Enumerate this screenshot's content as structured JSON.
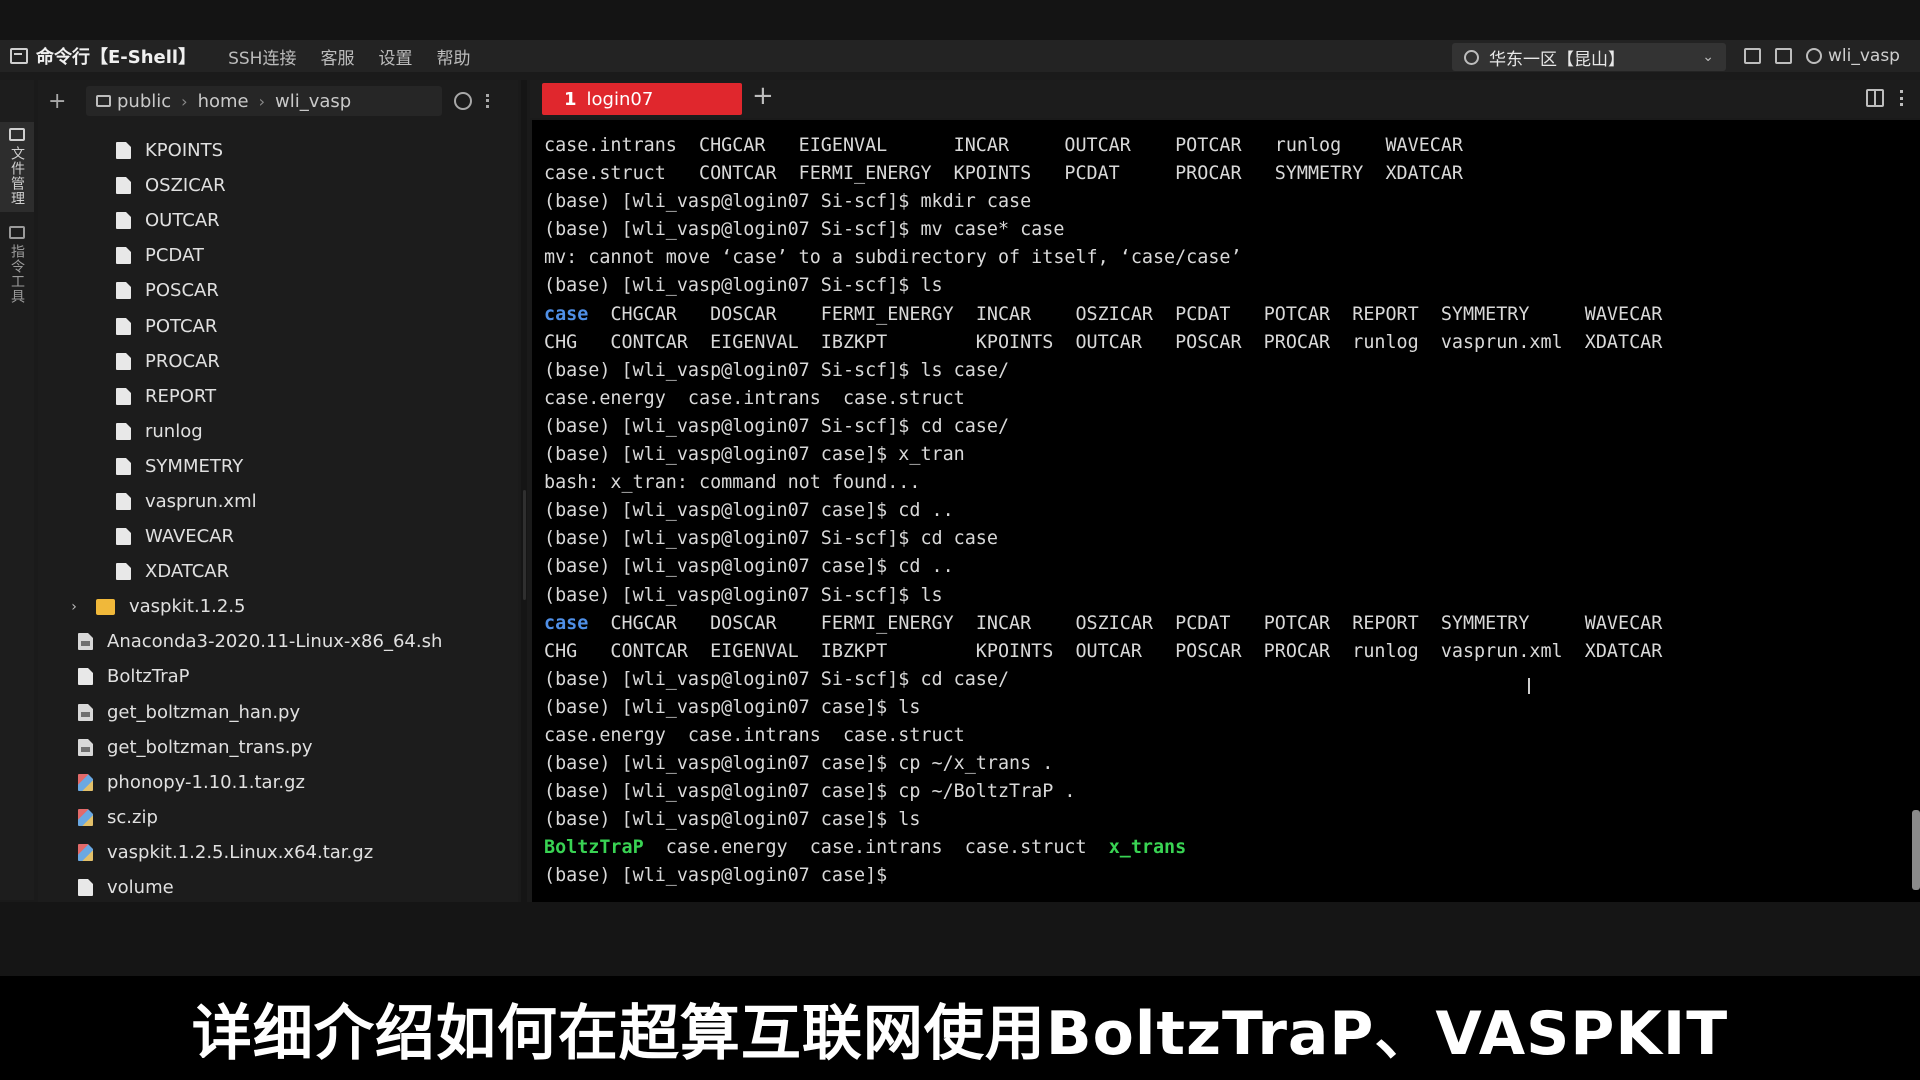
{
  "app": {
    "title": "命令行【E-Shell】",
    "menu": [
      "SSH连接",
      "客服",
      "设置",
      "帮助"
    ],
    "region": "华东一区【昆山】",
    "user": "wli_vasp"
  },
  "rail": {
    "files": "文件管理",
    "commands": "指令工具"
  },
  "filepanel": {
    "breadcrumb": [
      "public",
      "home",
      "wli_vasp"
    ],
    "files": [
      {
        "name": "KPOINTS",
        "kind": "file",
        "level": "child"
      },
      {
        "name": "OSZICAR",
        "kind": "file",
        "level": "child"
      },
      {
        "name": "OUTCAR",
        "kind": "file",
        "level": "child"
      },
      {
        "name": "PCDAT",
        "kind": "file",
        "level": "child"
      },
      {
        "name": "POSCAR",
        "kind": "file",
        "level": "child"
      },
      {
        "name": "POTCAR",
        "kind": "file",
        "level": "child"
      },
      {
        "name": "PROCAR",
        "kind": "file",
        "level": "child"
      },
      {
        "name": "REPORT",
        "kind": "file",
        "level": "child"
      },
      {
        "name": "runlog",
        "kind": "file",
        "level": "child"
      },
      {
        "name": "SYMMETRY",
        "kind": "file",
        "level": "child"
      },
      {
        "name": "vasprun.xml",
        "kind": "file",
        "level": "child"
      },
      {
        "name": "WAVECAR",
        "kind": "file",
        "level": "child"
      },
      {
        "name": "XDATCAR",
        "kind": "file",
        "level": "child"
      },
      {
        "name": "vaspkit.1.2.5",
        "kind": "folder",
        "level": "root"
      },
      {
        "name": "Anaconda3-2020.11-Linux-x86_64.sh",
        "kind": "script",
        "level": "root"
      },
      {
        "name": "BoltzTraP",
        "kind": "file",
        "level": "root"
      },
      {
        "name": "get_boltzman_han.py",
        "kind": "script",
        "level": "root"
      },
      {
        "name": "get_boltzman_trans.py",
        "kind": "script",
        "level": "root"
      },
      {
        "name": "phonopy-1.10.1.tar.gz",
        "kind": "archive",
        "level": "root"
      },
      {
        "name": "sc.zip",
        "kind": "archive",
        "level": "root"
      },
      {
        "name": "vaspkit.1.2.5.Linux.x64.tar.gz",
        "kind": "archive",
        "level": "root"
      },
      {
        "name": "volume",
        "kind": "file",
        "level": "root"
      }
    ]
  },
  "tabs": [
    {
      "num": "1",
      "label": "login07"
    }
  ],
  "terminal": {
    "lines": [
      [
        {
          "t": "case.intrans  CHGCAR   EIGENVAL      INCAR     OUTCAR    POTCAR   runlog    WAVECAR"
        }
      ],
      [
        {
          "t": "case.struct   CONTCAR  FERMI_ENERGY  KPOINTS   PCDAT     PROCAR   SYMMETRY  XDATCAR"
        }
      ],
      [
        {
          "t": "(base) [wli_vasp@login07 Si-scf]$ mkdir case"
        }
      ],
      [
        {
          "t": "(base) [wli_vasp@login07 Si-scf]$ mv case* case"
        }
      ],
      [
        {
          "t": "mv: cannot move ‘case’ to a subdirectory of itself, ‘case/case’"
        }
      ],
      [
        {
          "t": "(base) [wli_vasp@login07 Si-scf]$ ls"
        }
      ],
      [
        {
          "t": "case",
          "c": "blue"
        },
        {
          "t": "  CHGCAR   DOSCAR    FERMI_ENERGY  INCAR    OSZICAR  PCDAT   POTCAR  REPORT  SYMMETRY     WAVECAR"
        }
      ],
      [
        {
          "t": "CHG   CONTCAR  EIGENVAL  IBZKPT        KPOINTS  OUTCAR   POSCAR  PROCAR  runlog  vasprun.xml  XDATCAR"
        }
      ],
      [
        {
          "t": "(base) [wli_vasp@login07 Si-scf]$ ls case/"
        }
      ],
      [
        {
          "t": "case.energy  case.intrans  case.struct"
        }
      ],
      [
        {
          "t": "(base) [wli_vasp@login07 Si-scf]$ cd case/"
        }
      ],
      [
        {
          "t": "(base) [wli_vasp@login07 case]$ x_tran"
        }
      ],
      [
        {
          "t": "bash: x_tran: command not found..."
        }
      ],
      [
        {
          "t": "(base) [wli_vasp@login07 case]$ cd .."
        }
      ],
      [
        {
          "t": "(base) [wli_vasp@login07 Si-scf]$ cd case"
        }
      ],
      [
        {
          "t": "(base) [wli_vasp@login07 case]$ cd .."
        }
      ],
      [
        {
          "t": "(base) [wli_vasp@login07 Si-scf]$ ls"
        }
      ],
      [
        {
          "t": "case",
          "c": "blue"
        },
        {
          "t": "  CHGCAR   DOSCAR    FERMI_ENERGY  INCAR    OSZICAR  PCDAT   POTCAR  REPORT  SYMMETRY     WAVECAR"
        }
      ],
      [
        {
          "t": "CHG   CONTCAR  EIGENVAL  IBZKPT        KPOINTS  OUTCAR   POSCAR  PROCAR  runlog  vasprun.xml  XDATCAR"
        }
      ],
      [
        {
          "t": "(base) [wli_vasp@login07 Si-scf]$ cd case/"
        }
      ],
      [
        {
          "t": "(base) [wli_vasp@login07 case]$ ls"
        }
      ],
      [
        {
          "t": "case.energy  case.intrans  case.struct"
        }
      ],
      [
        {
          "t": "(base) [wli_vasp@login07 case]$ cp ~/x_trans ."
        }
      ],
      [
        {
          "t": "(base) [wli_vasp@login07 case]$ cp ~/BoltzTraP ."
        }
      ],
      [
        {
          "t": "(base) [wli_vasp@login07 case]$ ls"
        }
      ],
      [
        {
          "t": "BoltzTraP",
          "c": "green"
        },
        {
          "t": "  case.energy  case.intrans  case.struct  "
        },
        {
          "t": "x_trans",
          "c": "green"
        }
      ],
      [
        {
          "t": "(base) [wli_vasp@login07 case]$ "
        }
      ]
    ]
  },
  "subtitle": "详细介绍如何在超算互联网使用BoltzTraP、VASPKIT"
}
